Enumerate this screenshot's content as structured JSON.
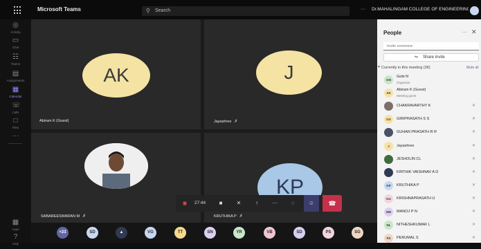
{
  "app": {
    "name": "Microsoft Teams",
    "search_placeholder": "Search",
    "more": "···",
    "org": "Dr.MAHALINGAM COLLEGE OF ENGINEERING AN..."
  },
  "rail": [
    {
      "label": "Activity",
      "icon": "bell-icon",
      "glyph": "◎"
    },
    {
      "label": "Chat",
      "icon": "chat-icon",
      "glyph": "▭"
    },
    {
      "label": "Teams",
      "icon": "teams-icon",
      "glyph": "☷"
    },
    {
      "label": "Assignments",
      "icon": "assignments-icon",
      "glyph": "▤"
    },
    {
      "label": "Calendar",
      "icon": "calendar-icon",
      "glyph": "▦"
    },
    {
      "label": "Calls",
      "icon": "phone-icon",
      "glyph": "☏"
    },
    {
      "label": "Files",
      "icon": "file-icon",
      "glyph": "□"
    },
    {
      "label": "",
      "icon": "more-icon",
      "glyph": "···"
    }
  ],
  "rail_bottom": [
    {
      "label": "Apps",
      "icon": "apps-icon",
      "glyph": "▦"
    },
    {
      "label": "Help",
      "icon": "help-icon",
      "glyph": "?"
    }
  ],
  "tiles": [
    {
      "initials": "AK",
      "name": "Abiram K (Guest)",
      "bg": "#f4e3a3",
      "fg": "#3a3a3a",
      "mic_off": false
    },
    {
      "initials": "J",
      "name": "Jayashree",
      "bg": "#f4e3a3",
      "fg": "#3a3a3a",
      "mic_off": true
    },
    {
      "initials": "",
      "name": "SABAREESWARAN M",
      "bg": "#e9e9e9",
      "fg": "#333",
      "mic_off": true
    },
    {
      "initials": "KP",
      "name": "KRUTHIKA P",
      "bg": "#a9c7e6",
      "fg": "#2b3a55",
      "mic_off": true
    }
  ],
  "controls": {
    "timer": "27:44",
    "record": "◉",
    "camera": "■",
    "mic": "✕",
    "share": "↑",
    "more": "···",
    "chat": "◌",
    "people": "☺",
    "hangup": "☎"
  },
  "strip": [
    {
      "label": "+23",
      "bg": "#6264a7",
      "fg": "#ffffff"
    },
    {
      "label": "SD",
      "bg": "#c9d8f0",
      "fg": "#2a2a2a"
    },
    {
      "label": "▲",
      "bg": "#2f3a52",
      "fg": "#ffffff"
    },
    {
      "label": "VG",
      "bg": "#c7d6f2",
      "fg": "#2a2a2a"
    },
    {
      "label": "TT",
      "bg": "#f7d98c",
      "fg": "#2a2a2a"
    },
    {
      "label": "SN",
      "bg": "#dcd0f2",
      "fg": "#2a2a2a"
    },
    {
      "label": "YR",
      "bg": "#c8e6c9",
      "fg": "#2a2a2a"
    },
    {
      "label": "VB",
      "bg": "#efc5d4",
      "fg": "#2a2a2a"
    },
    {
      "label": "SD",
      "bg": "#d7cfee",
      "fg": "#2a2a2a"
    },
    {
      "label": "PS",
      "bg": "#f3d5dd",
      "fg": "#2a2a2a"
    },
    {
      "label": "SG",
      "bg": "#f0d6c4",
      "fg": "#2a2a2a"
    }
  ],
  "panel": {
    "title": "People",
    "more": "···",
    "close": "✕",
    "invite_placeholder": "Invite someone",
    "share_invite": "Share invite",
    "section_label": "Currently in this meeting (36)",
    "mute_all": "Mute all",
    "participants": [
      {
        "initials": "GN",
        "name": "Gobi N",
        "role": "Organiser",
        "bg": "#c8e6c9",
        "photo": false,
        "mic_off": false
      },
      {
        "initials": "AK",
        "name": "Abiram K (Guest)",
        "role": "Meeting guest",
        "bg": "#f7e2a6",
        "photo": false,
        "mic_off": false
      },
      {
        "initials": "",
        "name": "CHAKRAVARTHY K",
        "role": "",
        "bg": "#7b6f6a",
        "photo": true,
        "mic_off": true
      },
      {
        "initials": "GS",
        "name": "GIRIPRASATH S S",
        "role": "",
        "bg": "#f7e2a6",
        "photo": false,
        "mic_off": true
      },
      {
        "initials": "",
        "name": "GUHAN PRASATH R R",
        "role": "",
        "bg": "#4b5163",
        "photo": true,
        "mic_off": true
      },
      {
        "initials": "J",
        "name": "Jayashree",
        "role": "",
        "bg": "#f7e2a6",
        "photo": false,
        "mic_off": true
      },
      {
        "initials": "",
        "name": "JESHOLIN CL",
        "role": "",
        "bg": "#3f6b3f",
        "photo": true,
        "mic_off": true
      },
      {
        "initials": "",
        "name": "KIRTHIK VAISHNAV A D",
        "role": "",
        "bg": "#2f3a52",
        "photo": true,
        "mic_off": true
      },
      {
        "initials": "KP",
        "name": "KRUTHIKA P",
        "role": "",
        "bg": "#c7d6f2",
        "photo": false,
        "mic_off": true
      },
      {
        "initials": "KU",
        "name": "KRISHNAPRASATH U",
        "role": "",
        "bg": "#f3d5dd",
        "photo": false,
        "mic_off": true
      },
      {
        "initials": "MN",
        "name": "MANOJ P N",
        "role": "",
        "bg": "#dcd0f2",
        "photo": false,
        "mic_off": true
      },
      {
        "initials": "NL",
        "name": "NITHESHKUMAR L",
        "role": "",
        "bg": "#c8e6c9",
        "photo": false,
        "mic_off": true
      },
      {
        "initials": "PS",
        "name": "PERUMAL S",
        "role": "",
        "bg": "#f0d6c4",
        "photo": false,
        "mic_off": true
      }
    ]
  }
}
